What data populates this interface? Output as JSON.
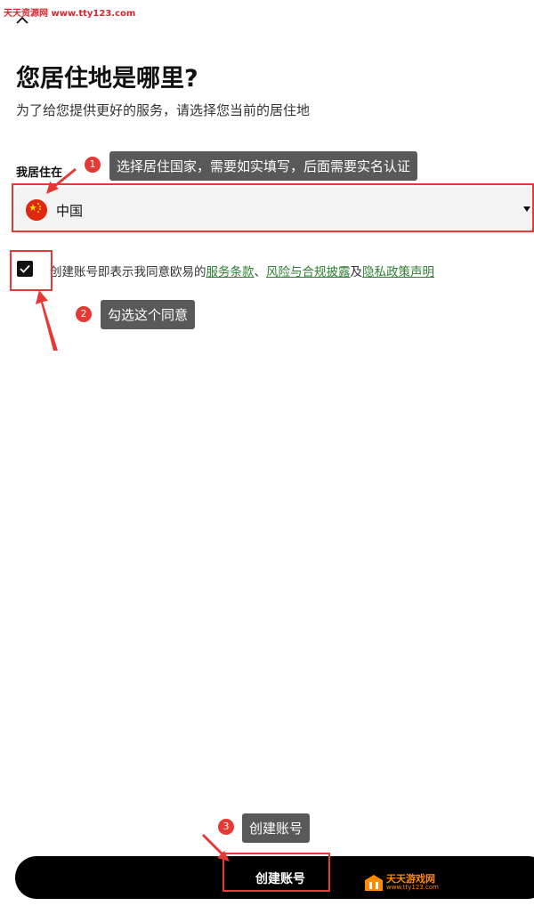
{
  "watermark_top": "天天资源网 www.tty123.com",
  "page": {
    "title": "您居住地是哪里?",
    "subtitle": "为了给您提供更好的服务，请选择您当前的居住地",
    "residence_label": "我居住在",
    "country": "中国"
  },
  "agreement": {
    "prefix": "创建账号即表示我同意欧易的",
    "terms": "服务条款",
    "sep": "、",
    "risk": "风险与合规披露",
    "and": "及",
    "privacy": "隐私政策声明"
  },
  "create_button_label": "创建账号",
  "annotations": [
    {
      "num": "1",
      "text": "选择居住国家，需要如实填写，后面需要实名认证"
    },
    {
      "num": "2",
      "text": "勾选这个同意"
    },
    {
      "num": "3",
      "text": "创建账号"
    }
  ],
  "logo": {
    "name": "天天游戏网",
    "url": "www.tty123.com"
  },
  "colors": {
    "accent": "#e53935",
    "link": "#2e7d32",
    "button": "#000000"
  }
}
